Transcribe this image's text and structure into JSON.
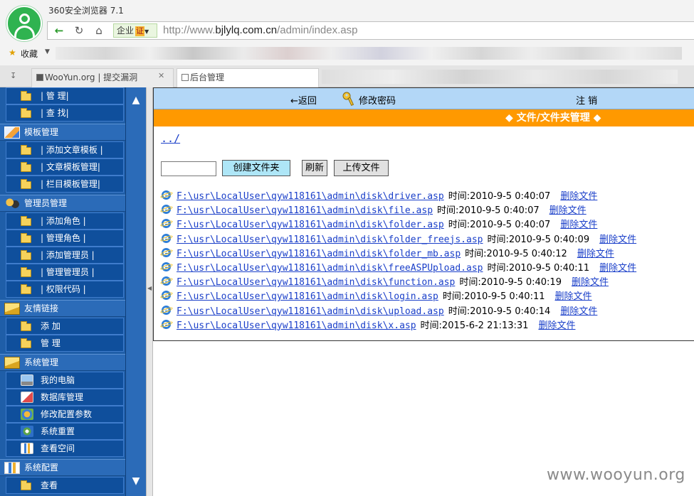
{
  "browser": {
    "app_title": "360安全浏览器 7.1",
    "zone_label": "企业",
    "zone_cert": "证",
    "url_prefix": "http://www.",
    "url_domain": "bjlylq.com.cn",
    "url_path": "/admin/index.asp",
    "bookmarks_label": "收藏",
    "tabs": [
      {
        "label": "WooYun.org | 提交漏洞"
      },
      {
        "label": "后台管理"
      }
    ]
  },
  "sidebar": {
    "items": [
      {
        "label": "| 管 理|"
      },
      {
        "label": "| 查 找|"
      },
      {
        "label": "模板管理"
      },
      {
        "label": "| 添加文章模板 |"
      },
      {
        "label": "| 文章模板管理|"
      },
      {
        "label": "| 栏目模板管理|"
      },
      {
        "label": "管理员管理"
      },
      {
        "label": "| 添加角色 |"
      },
      {
        "label": "| 管理角色 |"
      },
      {
        "label": "| 添加管理员 |"
      },
      {
        "label": "| 管理管理员 |"
      },
      {
        "label": "| 权限代码 |"
      },
      {
        "label": "友情链接"
      },
      {
        "label": "添 加"
      },
      {
        "label": "管 理"
      },
      {
        "label": "系统管理"
      },
      {
        "label": "我的电脑"
      },
      {
        "label": "数据库管理"
      },
      {
        "label": "修改配置参数"
      },
      {
        "label": "系统重置"
      },
      {
        "label": "查看空间"
      },
      {
        "label": "系统配置"
      },
      {
        "label": "查看"
      }
    ]
  },
  "topbar": {
    "back_label": "←返回",
    "password_label": "修改密码",
    "logout_label": "注 销"
  },
  "main": {
    "section_title": "◆ 文件/文件夹管理 ◆",
    "parent_link": "../",
    "create_folder_label": "创建文件夹",
    "refresh_label": "刷新",
    "upload_label": "上传文件",
    "files": [
      {
        "path": "F:\\usr\\LocalUser\\qyw118161\\admin\\disk\\driver.asp",
        "time": "时间:2010-9-5 0:40:07",
        "delete": "删除文件"
      },
      {
        "path": "F:\\usr\\LocalUser\\qyw118161\\admin\\disk\\file.asp",
        "time": "时间:2010-9-5 0:40:07",
        "delete": "删除文件"
      },
      {
        "path": "F:\\usr\\LocalUser\\qyw118161\\admin\\disk\\folder.asp",
        "time": "时间:2010-9-5 0:40:07",
        "delete": "删除文件"
      },
      {
        "path": "F:\\usr\\LocalUser\\qyw118161\\admin\\disk\\folder_freejs.asp",
        "time": "时间:2010-9-5 0:40:09",
        "delete": "删除文件"
      },
      {
        "path": "F:\\usr\\LocalUser\\qyw118161\\admin\\disk\\folder_mb.asp",
        "time": "时间:2010-9-5 0:40:12",
        "delete": "删除文件"
      },
      {
        "path": "F:\\usr\\LocalUser\\qyw118161\\admin\\disk\\freeASPUpload.asp",
        "time": "时间:2010-9-5 0:40:11",
        "delete": "删除文件"
      },
      {
        "path": "F:\\usr\\LocalUser\\qyw118161\\admin\\disk\\function.asp",
        "time": "时间:2010-9-5 0:40:19",
        "delete": "删除文件"
      },
      {
        "path": "F:\\usr\\LocalUser\\qyw118161\\admin\\disk\\login.asp",
        "time": "时间:2010-9-5 0:40:11",
        "delete": "删除文件"
      },
      {
        "path": "F:\\usr\\LocalUser\\qyw118161\\admin\\disk\\upload.asp",
        "time": "时间:2010-9-5 0:40:14",
        "delete": "删除文件"
      },
      {
        "path": "F:\\usr\\LocalUser\\qyw118161\\admin\\disk\\x.asp",
        "time": "时间:2015-6-2 21:13:31",
        "delete": "删除文件"
      }
    ]
  },
  "watermark": "www.wooyun.org",
  "colors": {
    "sidebar_bg": "#1f5ea8",
    "topbar_bg": "#b3d7f7",
    "section_bar": "#ff9900",
    "link": "#1a3fc9",
    "create_button": "#aee6f7"
  }
}
